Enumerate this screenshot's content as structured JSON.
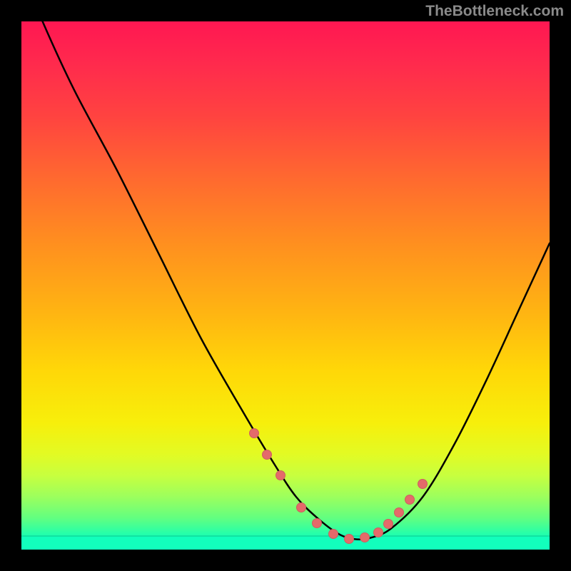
{
  "watermark": "TheBottleneck.com",
  "colors": {
    "marker": "#e46a6a",
    "curve": "#000000"
  },
  "chart_data": {
    "type": "line",
    "title": "",
    "xlabel": "",
    "ylabel": "",
    "xlim": [
      0,
      100
    ],
    "ylim": [
      0,
      100
    ],
    "series": [
      {
        "name": "bottleneck-curve",
        "x": [
          0,
          4,
          10,
          18,
          26,
          34,
          42,
          48,
          52,
          56,
          60,
          63,
          66,
          70,
          76,
          82,
          88,
          94,
          100
        ],
        "y": [
          110,
          100,
          87,
          72,
          56,
          40,
          26,
          16,
          10,
          6,
          3,
          2,
          2.2,
          4,
          10,
          20,
          32,
          45,
          58
        ]
      }
    ],
    "markers": {
      "name": "highlight-points",
      "x": [
        44,
        46.5,
        49,
        53,
        56,
        59,
        62,
        65,
        67.5,
        69.5,
        71.5,
        73.5,
        76
      ],
      "y": [
        22,
        18,
        14,
        8,
        5,
        3,
        2,
        2.3,
        3.2,
        4.8,
        7,
        9.5,
        12.5
      ]
    }
  }
}
